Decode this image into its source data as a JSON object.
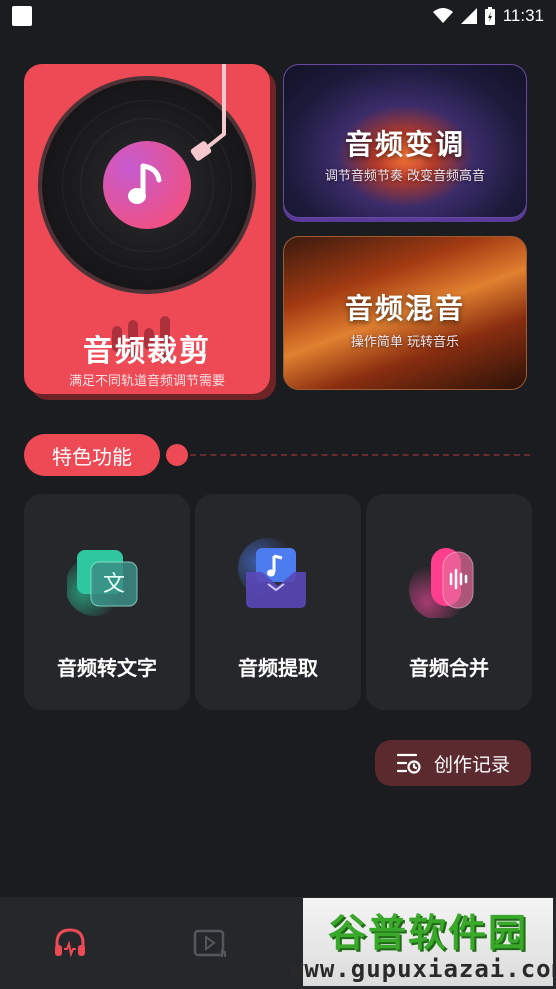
{
  "status_bar": {
    "time": "11:31"
  },
  "cards": {
    "trim": {
      "title": "音频裁剪",
      "subtitle": "满足不同轨道音频调节需要"
    },
    "pitch": {
      "title": "音频变调",
      "subtitle": "调节音频节奏 改变音频高音"
    },
    "mix": {
      "title": "音频混音",
      "subtitle": "操作简单 玩转音乐"
    }
  },
  "section": {
    "title": "特色功能"
  },
  "features": [
    {
      "label": "音频转文字",
      "icon": "audio-to-text-icon",
      "glyph": "文"
    },
    {
      "label": "音频提取",
      "icon": "audio-extract-icon"
    },
    {
      "label": "音频合并",
      "icon": "audio-merge-icon"
    }
  ],
  "records": {
    "label": "创作记录"
  },
  "bottom_nav": [
    {
      "icon": "headphones-icon",
      "active": true
    },
    {
      "icon": "video-play-icon",
      "active": false
    }
  ],
  "watermark": {
    "title": "谷普软件园",
    "url": "www.gupuxiazai.com"
  },
  "colors": {
    "accent": "#ee4a55",
    "background": "#1b1c20",
    "tile": "#26272b"
  }
}
